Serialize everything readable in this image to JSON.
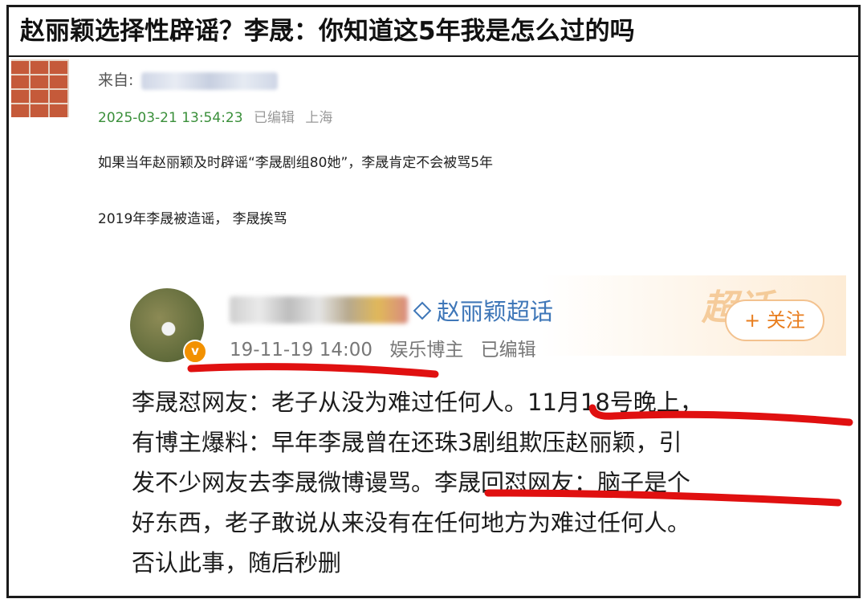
{
  "headline": "赵丽颖选择性辟谣？李晟：你知道这5年我是怎么过的吗",
  "post": {
    "from_label": "来自:",
    "time": "2025-03-21 13:54:23",
    "edited": "已编辑",
    "location": "上海",
    "para1": "如果当年赵丽颖及时辟谣“李晟剧组80她”，李晟肯定不会被骂5年",
    "para2": "2019年李晟被造谣，  李晟挨骂"
  },
  "embed": {
    "topic_tag": "赵丽颖超话",
    "watermark": "超话",
    "follow_button": "+ 关注",
    "verified_badge": "v",
    "date": "19-11-19 14:00",
    "role": "娱乐博主",
    "edited": "已编辑",
    "lines": [
      "李晟怼网友：老子从没为难过任何人。11月18号晚上，",
      "有博主爆料：早年李晟曾在还珠3剧组欺压赵丽颖，引",
      "发不少网友去李晟微博谩骂。李晟回怼网友：脑子是个",
      "好东西，老子敢说从来没有在任何地方为难过任何人。",
      "否认此事，随后秒删"
    ]
  },
  "colors": {
    "time_green": "#3a8f3a",
    "topic_blue": "#3f77b8",
    "follow_orange": "#e87d1e",
    "marker_red": "#e01010"
  }
}
